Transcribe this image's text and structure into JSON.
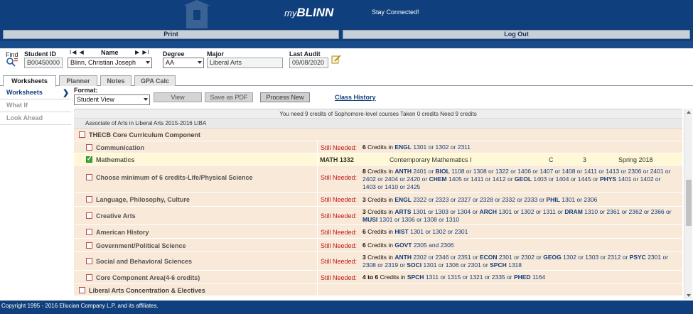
{
  "banner": {
    "brand_prefix": "my",
    "brand_name": "BLINN",
    "tagline": "Stay Connected!"
  },
  "nav": {
    "print": "Print",
    "logout": "Log Out"
  },
  "search": {
    "find_label": "Find",
    "student_id_label": "Student ID",
    "student_id_value": "B00450000",
    "name_label": "Name",
    "name_value": "Blinn, Christian Joseph",
    "degree_label": "Degree",
    "degree_value": "AA",
    "major_label": "Major",
    "major_value": "Liberal Arts",
    "last_audit_label": "Last Audit",
    "last_audit_value": "09/08/2020",
    "pager_left": "I◀ ◀",
    "pager_right": "▶ ▶I"
  },
  "tabs": [
    "Worksheets",
    "Planner",
    "Notes",
    "GPA Calc"
  ],
  "leftnav": [
    "Worksheets",
    "What If",
    "Look Ahead"
  ],
  "toolbar": {
    "format_label": "Format:",
    "format_value": "Student View",
    "view": "View",
    "save_pdf": "Save as PDF",
    "process_new": "Process New",
    "class_history": "Class History"
  },
  "worksheet": {
    "summary": "You need 9 credits of Sophomore-level courses  Taken 0 credits  Need 9 credits",
    "program": "Associate of Arts in Liberal Arts 2015-2016 LIBA",
    "core_heading": "THECB Core Curriculum Component",
    "still_needed": "Still Needed:",
    "communication": {
      "name": "Communication",
      "n": "6",
      "t": " Credits in ",
      "s": "ENGL",
      "c": " 1301 or 1302 or 2311"
    },
    "mathematics": {
      "name": "Mathematics",
      "course": "MATH 1332",
      "title": "Contemporary Mathematics I",
      "grade": "C",
      "credits": "3",
      "term": "Spring 2018"
    },
    "life_science": {
      "name": "Choose minimum of 6 credits-Life/Physical Science",
      "n": "8",
      "t": " Credits in ",
      "s1": "ANTH",
      "c1": " 2401 or ",
      "s2": "BIOL",
      "c2": " 1108 or 1308 or 1322 or 1406 or 1407 or 1408 or 1411 or 1413 or 2306 or 2401 or 2402 or 2404 or 2420 or ",
      "s3": "CHEM",
      "c3": " 1405 or 1411 or 1412 or ",
      "s4": "GEOL",
      "c4": " 1403 or 1404 or 1445 or ",
      "s5": "PHYS",
      "c5": " 1401 or 1402 or 1403 or 1410 or 2425"
    },
    "language": {
      "name": "Language, Philosophy, Culture",
      "n": "3",
      "t": " Credits in ",
      "s1": "ENGL",
      "c1": " 2322 or 2323 or 2327 or 2328 or 2332 or 2333 or ",
      "s2": "PHIL",
      "c2": " 1301 or 2306"
    },
    "creative": {
      "name": "Creative Arts",
      "n": "3",
      "t": " Credits in ",
      "s1": "ARTS",
      "c1": " 1301 or 1303 or 1304 or ",
      "s2": "ARCH",
      "c2": " 1301 or 1302 or 1311 or ",
      "s3": "DRAM",
      "c3": " 1310 or 2361 or 2362 or 2366 or ",
      "s4": "MUSI",
      "c4": " 1301 or 1306 or 1308 or 1310"
    },
    "american_history": {
      "name": "American History",
      "n": "6",
      "t": " Credits in ",
      "s": "HIST",
      "c": " 1301 or 1302 or 2301"
    },
    "government": {
      "name": "Government/Political Science",
      "n": "6",
      "t": " Credits in ",
      "s": "GOVT",
      "c": " 2305 and 2306"
    },
    "social": {
      "name": "Social and Behavioral Sciences",
      "n": "3",
      "t": " Credits in ",
      "s1": "ANTH",
      "c1": " 2302 or 2346 or 2351 or ",
      "s2": "ECON",
      "c2": " 2301 or 2302 or ",
      "s3": "GEOG",
      "c3": " 1302 or 1303 or 2312 or ",
      "s4": "PSYC",
      "c4": " 2301 or 2308 or 2319 or ",
      "s5": "SOCI",
      "c5": " 1301 or 1306 or 2301 or ",
      "s6": "SPCH",
      "c6": " 1318"
    },
    "core_area": {
      "name": "Core Component Area(4-6 credits)",
      "n": "4 to 6",
      "t": " Credits in ",
      "s1": "SPCH",
      "c1": " 1311 or 1315 or 1321 or 2335 or ",
      "s2": "PHED",
      "c2": " 1164"
    },
    "liberal_arts": "Liberal Arts Concentration & Electives"
  },
  "footer": "Copyright 1995 - 2016 Ellucian Company L.P. and its affiliates.",
  "colors": {
    "brand": "#0f3f7c",
    "needed": "#c01818",
    "row": "#f9e9d9",
    "row_complete": "#fff8d6"
  }
}
